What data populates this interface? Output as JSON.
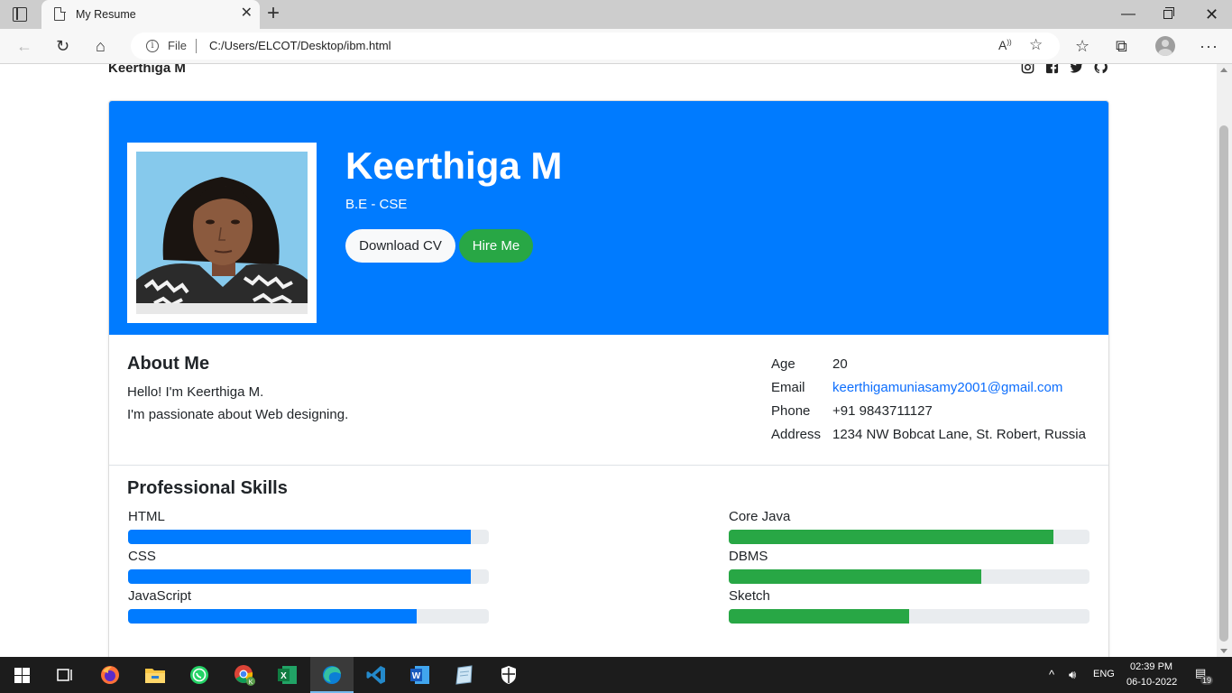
{
  "browser": {
    "tab_title": "My Resume",
    "address_prefix": "File",
    "url": "C:/Users/ELCOT/Desktop/ibm.html",
    "new_tab_glyph": "+",
    "close_glyph": "✕"
  },
  "nav": {
    "brand": "Keerthiga M",
    "social_icons": [
      "instagram-icon",
      "facebook-icon",
      "twitter-icon",
      "github-icon"
    ]
  },
  "hero": {
    "name": "Keerthiga M",
    "degree": "B.E - CSE",
    "download_label": "Download CV",
    "hire_label": "Hire Me"
  },
  "about": {
    "title": "About Me",
    "lines": [
      "Hello! I'm Keerthiga M.",
      "I'm passionate about Web designing."
    ],
    "info": [
      {
        "label": "Age",
        "value": "20"
      },
      {
        "label": "Email",
        "value": "keerthigamuniasamy2001@gmail.com"
      },
      {
        "label": "Phone",
        "value": "+91 9843711127"
      },
      {
        "label": "Address",
        "value": "1234 NW Bobcat Lane, St. Robert, Russia"
      }
    ]
  },
  "skills": {
    "title": "Professional Skills",
    "left": [
      {
        "name": "HTML",
        "level": 0.95
      },
      {
        "name": "CSS",
        "level": 0.95
      },
      {
        "name": "JavaScript",
        "level": 0.8
      }
    ],
    "right": [
      {
        "name": "Core Java",
        "level": 0.9
      },
      {
        "name": "DBMS",
        "level": 0.7
      },
      {
        "name": "Sketch",
        "level": 0.5
      }
    ]
  },
  "taskbar": {
    "apps": [
      "windows-start-icon",
      "task-view-icon",
      "firefox-icon",
      "file-explorer-icon",
      "whatsapp-icon",
      "chrome-icon",
      "excel-icon",
      "edge-icon",
      "vscode-icon",
      "word-icon",
      "notes-icon",
      "security-icon"
    ],
    "language": "ENG",
    "time": "02:39 PM",
    "date": "06-10-2022",
    "notification_count": "19"
  },
  "colors": {
    "primary": "#007bff",
    "success": "#28a745",
    "track": "#e9ecef",
    "link": "#0d6efd"
  }
}
